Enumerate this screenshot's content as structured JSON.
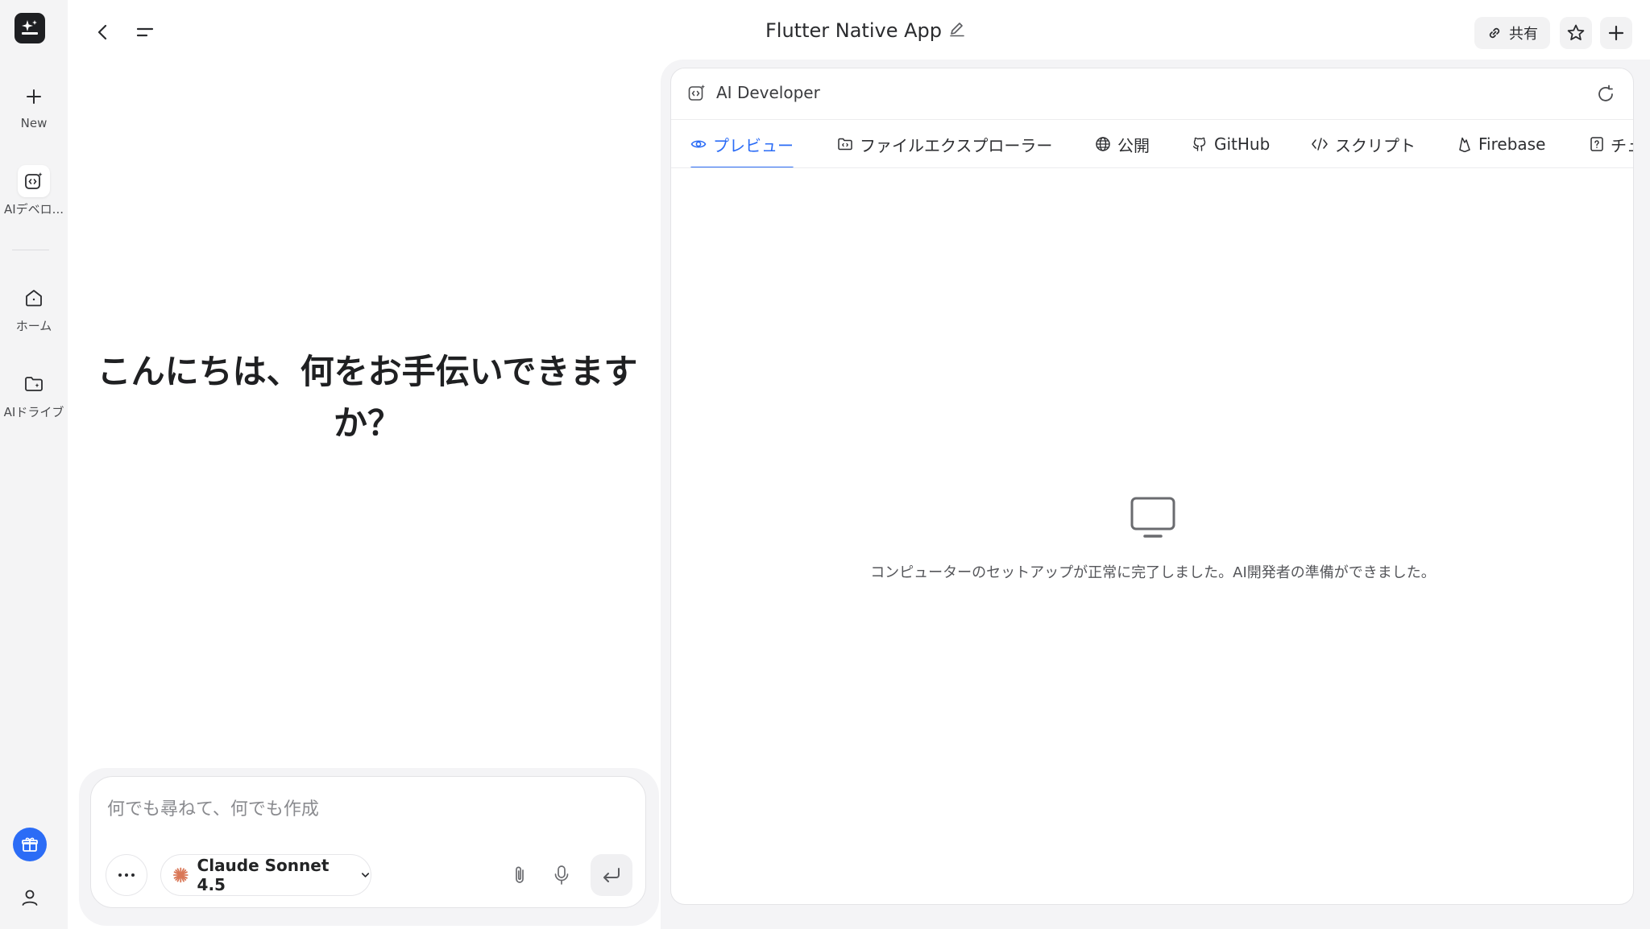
{
  "sidebar": {
    "new_label": "New",
    "ai_dev_label": "AIデベロ...",
    "home_label": "ホーム",
    "drive_label": "AIドライブ"
  },
  "topbar": {
    "title": "Flutter Native App",
    "share_label": "共有"
  },
  "greeting": "こんにちは、何をお手伝いできますか？",
  "chat": {
    "placeholder": "何でも尋ねて、何でも作成",
    "model_label": "Claude Sonnet 4.5"
  },
  "panel": {
    "title": "AI Developer",
    "tabs": [
      {
        "label": "プレビュー",
        "icon": "eye-icon"
      },
      {
        "label": "ファイルエクスプローラー",
        "icon": "folder-icon"
      },
      {
        "label": "公開",
        "icon": "globe-icon"
      },
      {
        "label": "GitHub",
        "icon": "github-icon"
      },
      {
        "label": "スクリプト",
        "icon": "code-icon"
      },
      {
        "label": "Firebase",
        "icon": "firebase-icon"
      },
      {
        "label": "チュ",
        "icon": "help-icon"
      }
    ],
    "empty_message": "コンピューターのセットアップが正常に完了しました。AI開発者の準備ができました。"
  },
  "colors": {
    "accent": "#2b6cf6",
    "sidebar_bg": "#f4f4f5"
  }
}
